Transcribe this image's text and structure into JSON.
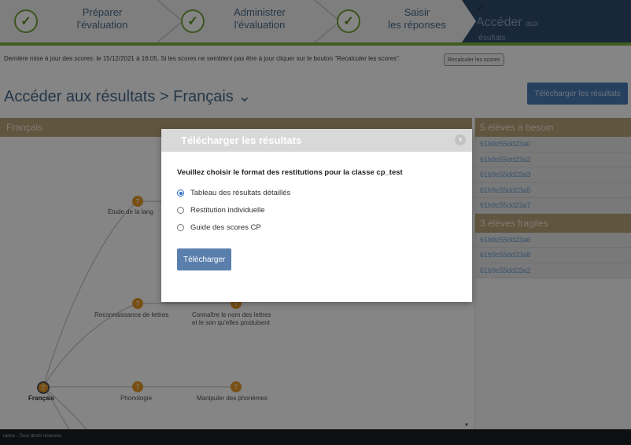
{
  "stepper": {
    "steps": [
      {
        "line1": "Préparer",
        "line2": "l'évaluation"
      },
      {
        "line1": "Administrer",
        "line2": "l'évaluation"
      },
      {
        "line1": "Saisir",
        "line2": "les réponses"
      },
      {
        "line1": "Accéder",
        "line2": "aux résultats"
      }
    ],
    "check_glyph": "✓"
  },
  "info": {
    "text": "Dernière mise à jour des scores: le 15/12/2021 à 16:05. Si les scores ne semblent pas être à jour cliquer sur le bouton \"Recalculer les scores\".",
    "recalc_label": "Recalculer les scores"
  },
  "page": {
    "title": "Accéder aux résultats  >  Français ⌄",
    "download_label": "Télécharger les résultats"
  },
  "tree": {
    "header": "Français",
    "node_value": "7",
    "labels": {
      "etude": "Étude de la lang",
      "reconnaissance": "Reconnaissance de lettres",
      "connaitre1": "Connaître le nom des lettres",
      "connaitre2": "et le son qu'elles produisent",
      "francais": "Français",
      "phonologie": "Phonologie",
      "manipuler": "Manipuler des phonèmes"
    }
  },
  "right_panel": {
    "group1": "5 élèves à besoin",
    "group1_students": [
      "61b9c55dd23a0",
      "61b9c55dd23a2",
      "61b9c55dd23a3",
      "61b9c55dd23a5",
      "61b9c55dd23a7"
    ],
    "group2": "3 élèves fragiles",
    "group2_students": [
      "61b9c55dd23a6",
      "61b9c55dd23a8",
      "61b9c55dd23a2"
    ]
  },
  "modal": {
    "title": "Télécharger les résultats",
    "close_glyph": "×",
    "question": "Veuillez choisir le format des restitutions pour la classe cp_test",
    "options": [
      "Tableau des résultats détaillés",
      "Restitution individuelle",
      "Guide des scores CP"
    ],
    "selected_index": 0,
    "submit_label": "Télécharger"
  },
  "footer": {
    "text": "rance - Tous droits réservés."
  },
  "colors": {
    "accent": "#2f4d6e",
    "green": "#7bb13a",
    "header_tan": "#b8a37a",
    "node_orange": "#e69a2a",
    "button_blue": "#5a7fad"
  }
}
